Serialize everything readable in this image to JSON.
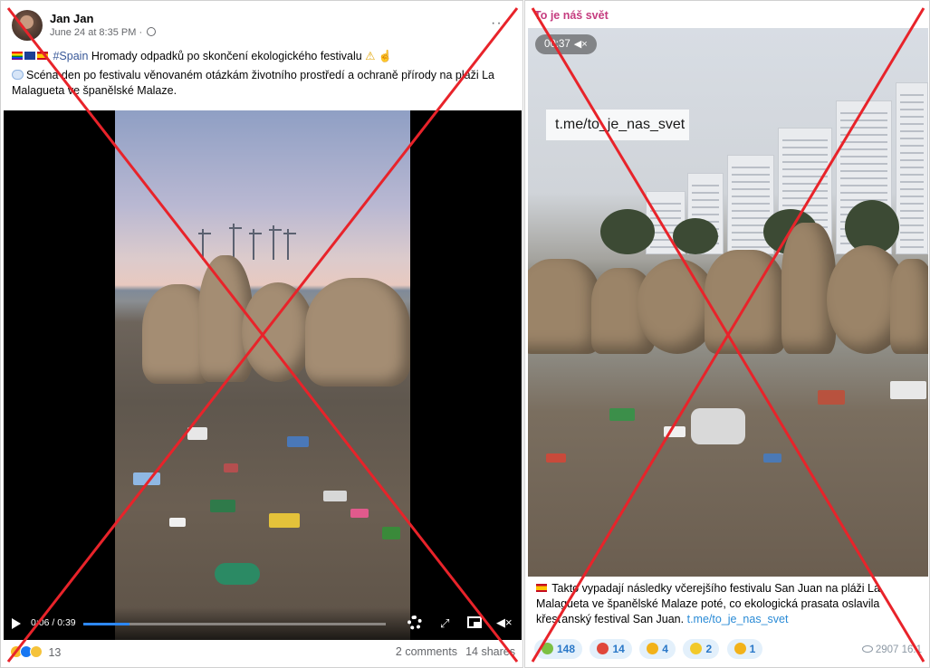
{
  "facebook": {
    "author": "Jan Jan",
    "timestamp": "June 24 at 8:35 PM",
    "hashtag": "#Spain",
    "headline": "Hromady odpadků po skončení ekologického festivalu",
    "body": "Scéna den po festivalu věnovaném otázkám životního prostředí a ochraně přírody na pláži La Malagueta ve španělské Malaze.",
    "video": {
      "time": "0:06 / 0:39",
      "progress_fraction": 0.154
    },
    "reactions_count": "13",
    "comments": "2 comments",
    "shares": "14 shares",
    "more_label": "···"
  },
  "telegram": {
    "channel": "To je náš svět",
    "video_time": "00:37",
    "watermark": "t.me/to_je_nas_svet",
    "caption": "Takto vypadají následky včerejšího festivalu San Juan na pláži La Malagueta ve španělské Malaze poté, co ekologická prasata oslavila křesťanský festival San Juan.",
    "link": "t.me/to_je_nas_svet",
    "reactions": [
      {
        "count": "148",
        "color": "#7cc043"
      },
      {
        "count": "14",
        "color": "#e0483b"
      },
      {
        "count": "4",
        "color": "#f2b21a"
      },
      {
        "count": "2",
        "color": "#f2c92a"
      },
      {
        "count": "1",
        "color": "#f2b21a"
      }
    ],
    "views": "2907",
    "time": "16:1"
  },
  "colors": {
    "cross": "#e8232a",
    "channel": "#c53c7f",
    "link": "#2a8bd6",
    "fb_progress": "#2d88ff"
  }
}
